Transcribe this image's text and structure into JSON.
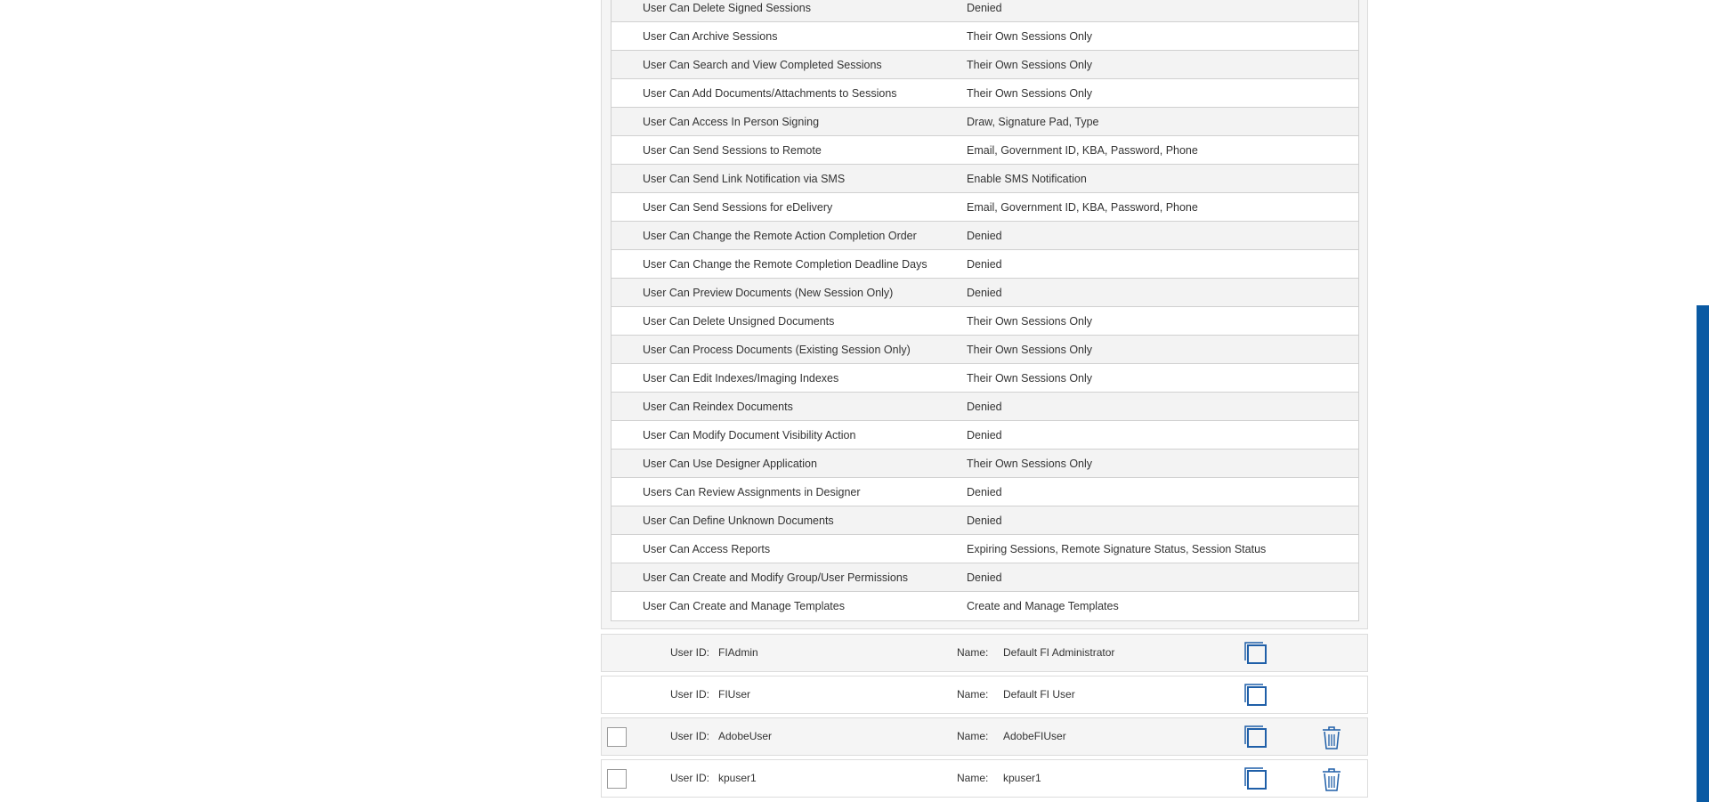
{
  "permissions": [
    {
      "name": "User Can Delete Signed Sessions",
      "value": "Denied"
    },
    {
      "name": "User Can Archive Sessions",
      "value": "Their Own Sessions Only"
    },
    {
      "name": "User Can Search and View Completed Sessions",
      "value": "Their Own Sessions Only"
    },
    {
      "name": "User Can Add Documents/Attachments to Sessions",
      "value": "Their Own Sessions Only"
    },
    {
      "name": "User Can Access In Person Signing",
      "value": "Draw, Signature Pad, Type"
    },
    {
      "name": "User Can Send Sessions to Remote",
      "value": "Email, Government ID, KBA, Password, Phone"
    },
    {
      "name": "User Can Send Link Notification via SMS",
      "value": "Enable SMS Notification"
    },
    {
      "name": "User Can Send Sessions for eDelivery",
      "value": "Email, Government ID, KBA, Password, Phone"
    },
    {
      "name": "User Can Change the Remote Action Completion Order",
      "value": "Denied"
    },
    {
      "name": "User Can Change the Remote Completion Deadline Days",
      "value": "Denied"
    },
    {
      "name": "User Can Preview Documents (New Session Only)",
      "value": "Denied"
    },
    {
      "name": "User Can Delete Unsigned Documents",
      "value": "Their Own Sessions Only"
    },
    {
      "name": "User Can Process Documents (Existing Session Only)",
      "value": "Their Own Sessions Only"
    },
    {
      "name": "User Can Edit Indexes/Imaging Indexes",
      "value": "Their Own Sessions Only"
    },
    {
      "name": "User Can Reindex Documents",
      "value": "Denied"
    },
    {
      "name": "User Can Modify Document Visibility Action",
      "value": "Denied"
    },
    {
      "name": "User Can Use Designer Application",
      "value": "Their Own Sessions Only"
    },
    {
      "name": "Users Can Review Assignments in Designer",
      "value": "Denied"
    },
    {
      "name": "User Can Define Unknown Documents",
      "value": "Denied"
    },
    {
      "name": "User Can Access Reports",
      "value": "Expiring Sessions, Remote Signature Status, Session Status"
    },
    {
      "name": "User Can Create and Modify Group/User Permissions",
      "value": "Denied"
    },
    {
      "name": "User Can Create and Manage Templates",
      "value": "Create and Manage Templates"
    }
  ],
  "users": {
    "id_label": "User ID:",
    "name_label": "Name:",
    "rows": [
      {
        "user_id": "FIAdmin",
        "name": "Default FI Administrator"
      },
      {
        "user_id": "FIUser",
        "name": "Default FI User"
      },
      {
        "user_id": "AdobeUser",
        "name": "AdobeFIUser"
      },
      {
        "user_id": "kpuser1",
        "name": "kpuser1"
      }
    ]
  },
  "icons": {
    "copy": "copy-icon",
    "delete": "trash-icon"
  },
  "colors": {
    "accent": "#1f5fa8",
    "sidebar": "#0a5aa3",
    "row_shade": "#f3f3f3",
    "border": "#d0d0d0"
  }
}
